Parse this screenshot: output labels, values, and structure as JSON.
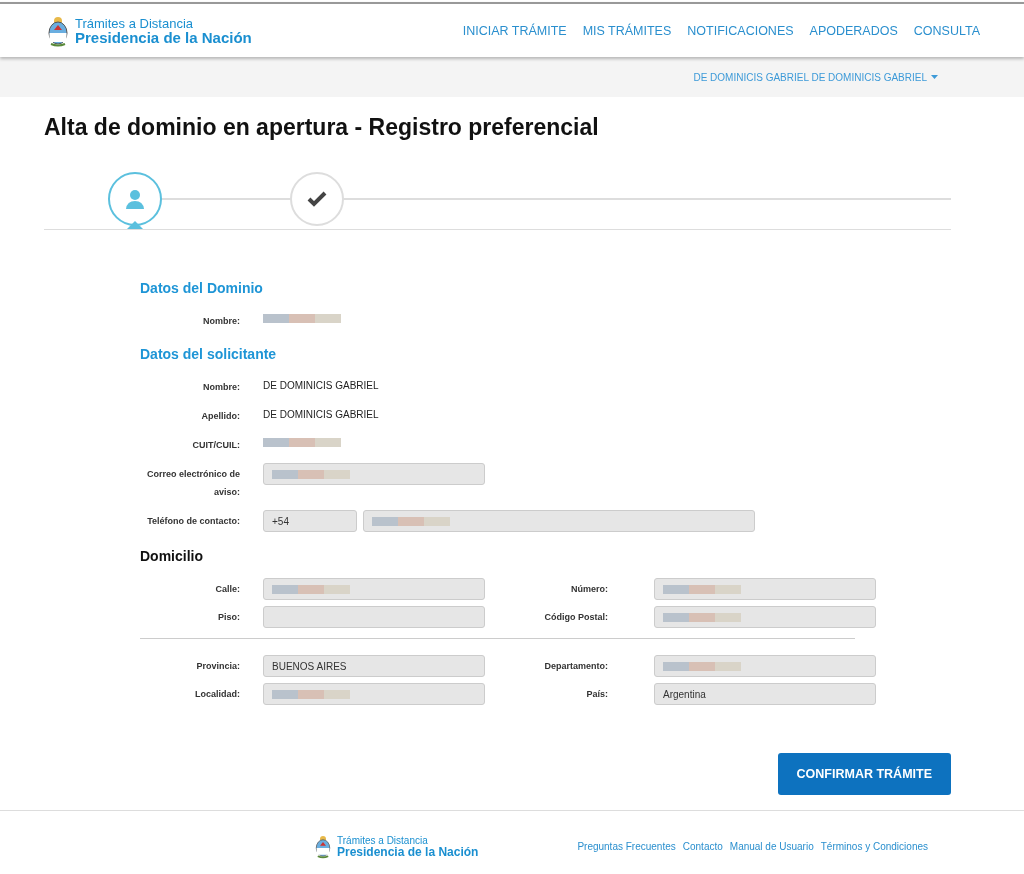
{
  "header": {
    "logo": {
      "line1": "Trámites a Distancia",
      "line2": "Presidencia de la Nación"
    },
    "nav": [
      {
        "label": "INICIAR TRÁMITE"
      },
      {
        "label": "MIS TRÁMITES"
      },
      {
        "label": "NOTIFICACIONES"
      },
      {
        "label": "APODERADOS"
      },
      {
        "label": "CONSULTA"
      }
    ]
  },
  "user_menu": {
    "label": "DE DOMINICIS GABRIEL DE DOMINICIS GABRIEL"
  },
  "title": "Alta de dominio en apertura - Registro preferencial",
  "steps": [
    {
      "kind": "person",
      "selected": true
    },
    {
      "kind": "check",
      "selected": false
    }
  ],
  "sections": [
    {
      "heading": "Datos del Dominio",
      "kind": "accent",
      "fields": [
        {
          "label": "Nombre:",
          "kind": "text",
          "redacted": true
        }
      ]
    },
    {
      "heading": "Datos del solicitante",
      "kind": "accent",
      "fields": [
        {
          "label": "Nombre:",
          "kind": "text",
          "value": "DE DOMINICIS GABRIEL"
        },
        {
          "label": "Apellido:",
          "kind": "text",
          "value": "DE DOMINICIS GABRIEL"
        },
        {
          "label": "CUIT/CUIL:",
          "kind": "text",
          "redacted": true
        },
        {
          "label": "Correo electrónico de aviso:",
          "kind": "input",
          "redacted": true
        },
        {
          "label": "Teléfono de contacto:",
          "kind": "phone",
          "prefix": "+54",
          "redacted": true
        }
      ]
    }
  ],
  "domicilio": {
    "heading": "Domicilio",
    "groups": [
      [
        {
          "label": "Calle:",
          "redacted": true
        },
        {
          "label": "Número:",
          "redacted": true
        },
        {
          "label": "Piso:"
        },
        {
          "label": "Código Postal:",
          "redacted": true
        }
      ],
      [
        {
          "label": "Provincia:",
          "value": "BUENOS AIRES"
        },
        {
          "label": "Departamento:",
          "redacted": true
        },
        {
          "label": "Localidad:",
          "redacted": true
        },
        {
          "label": "País:",
          "value": "Argentina"
        }
      ]
    ]
  },
  "confirm_button": "CONFIRMAR TRÁMITE",
  "footer": {
    "logo": {
      "line1": "Trámites a Distancia",
      "line2": "Presidencia de la Nación"
    },
    "links": [
      "Preguntas Frecuentes",
      "Contacto",
      "Manual de Usuario",
      "Términos y Condiciones"
    ]
  }
}
